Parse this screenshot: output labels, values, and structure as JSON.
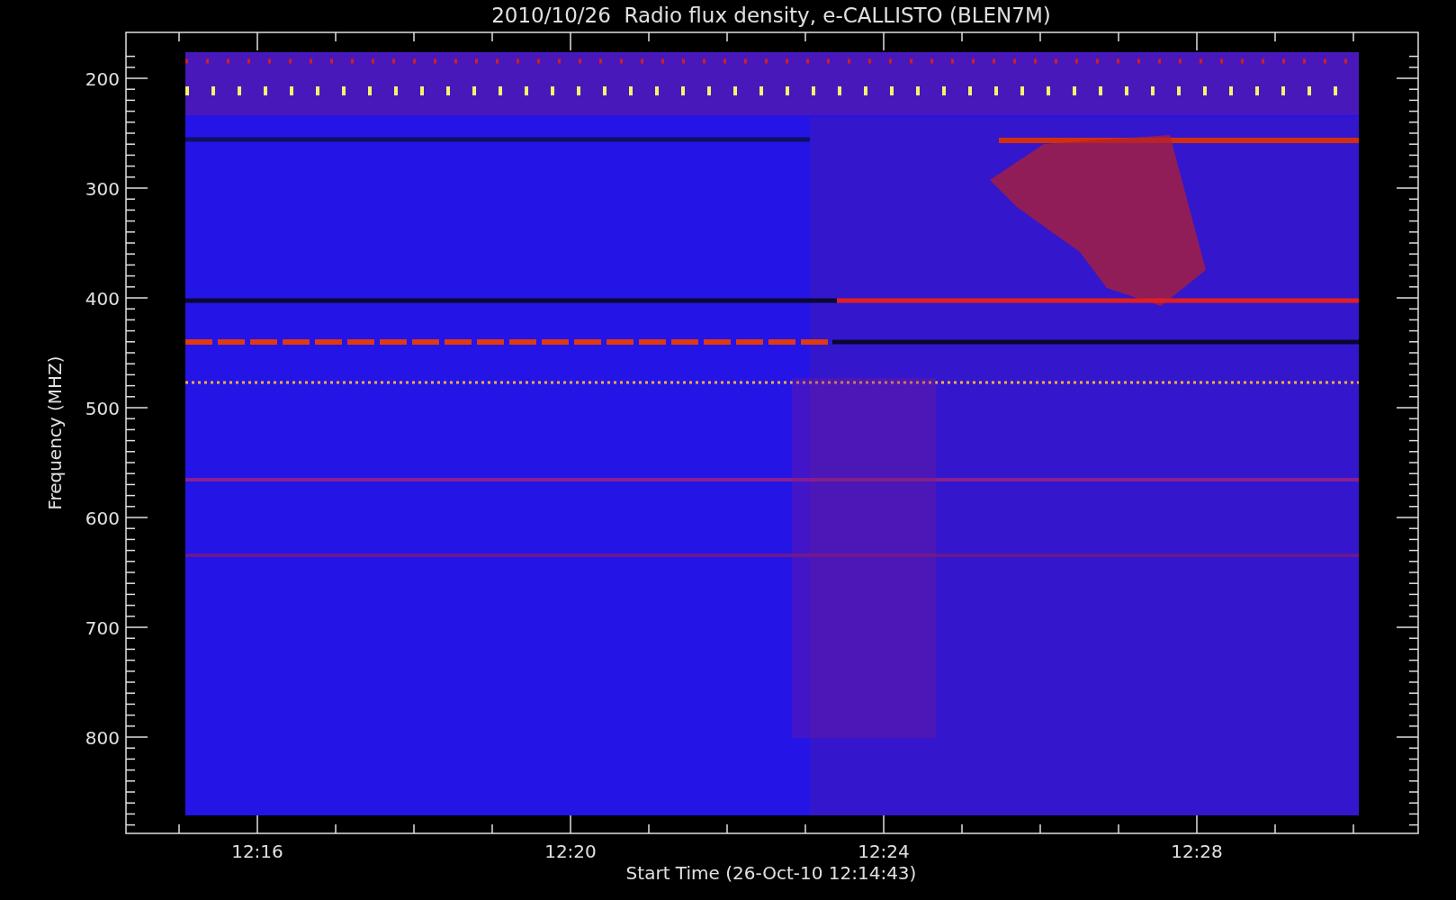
{
  "title": "2010/10/26  Radio flux density, e-CALLISTO (BLEN7M)",
  "y_axis": {
    "label": "Frequency (MHZ)",
    "ticks": [
      "200",
      "300",
      "400",
      "500",
      "600",
      "700",
      "800"
    ]
  },
  "x_axis": {
    "label": "Start Time (26-Oct-10 12:14:43)",
    "ticks": [
      "12:16",
      "12:20",
      "12:24",
      "12:28"
    ]
  }
}
